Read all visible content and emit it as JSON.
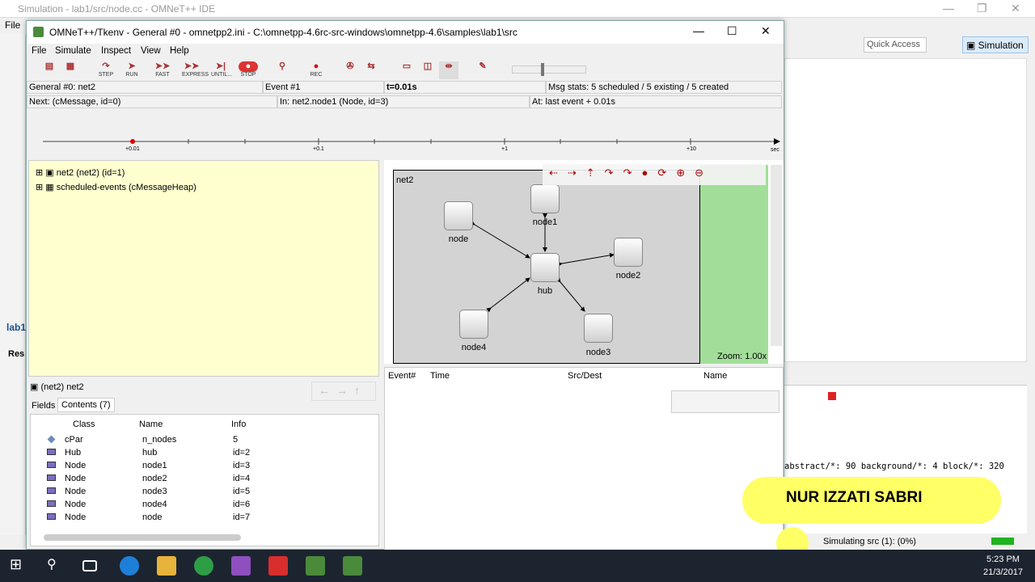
{
  "ide": {
    "title": "Simulation - lab1/src/node.cc - OMNeT++ IDE",
    "menu_file": "File",
    "quick_access": "Quick Access",
    "perspective": "Simulation",
    "left_tab1": "lab1",
    "left_tab2": "Res",
    "console_text": "abstract/*: 90  background/*: 4  block/*: 320",
    "status": "Simulating src (1): (0%)"
  },
  "tkenv": {
    "title": "OMNeT++/Tkenv - General #0 - omnetpp2.ini - C:\\omnetpp-4.6rc-src-windows\\omnetpp-4.6\\samples\\lab1\\src",
    "menu": [
      "File",
      "Simulate",
      "Inspect",
      "View",
      "Help"
    ],
    "tools": [
      "STEP",
      "RUN",
      "FAST",
      "EXPRESS",
      "UNTIL...",
      "STOP",
      "REC"
    ],
    "info": {
      "run": "General #0: net2",
      "event": "Event #1",
      "time": "t=0.01s",
      "msgstats": "Msg stats: 5 scheduled / 5 existing / 5 created",
      "next": "Next:  (cMessage, id=0)",
      "in": "In: net2.node1 (Node, id=3)",
      "at": "At: last event + 0.01s"
    },
    "timeline": [
      "+0.01",
      "+0.1",
      "+1",
      "+10",
      "sec"
    ],
    "tree": [
      "net2 (net2) (id=1)",
      "scheduled-events (cMessageHeap)"
    ],
    "network": {
      "name": "net2",
      "zoom": "Zoom: 1.00x",
      "nodes": {
        "node": "node",
        "node1": "node1",
        "node2": "node2",
        "hub": "hub",
        "node3": "node3",
        "node4": "node4"
      }
    },
    "log_cols": [
      "Event#",
      "Time",
      "Src/Dest",
      "Name"
    ],
    "obj_header": "(net2) net2",
    "tabs": [
      "Fields",
      "Contents (7)"
    ],
    "cols": [
      "Class",
      "Name",
      "Info"
    ],
    "rows": [
      [
        "cPar",
        "n_nodes",
        "5"
      ],
      [
        "Hub",
        "hub",
        "id=2"
      ],
      [
        "Node",
        "node1",
        "id=3"
      ],
      [
        "Node",
        "node2",
        "id=4"
      ],
      [
        "Node",
        "node3",
        "id=5"
      ],
      [
        "Node",
        "node4",
        "id=6"
      ],
      [
        "Node",
        "node",
        "id=7"
      ]
    ]
  },
  "taskbar": {
    "time": "5:23 PM",
    "date": "21/3/2017"
  },
  "banner": "NUR IZZATI SABRI"
}
